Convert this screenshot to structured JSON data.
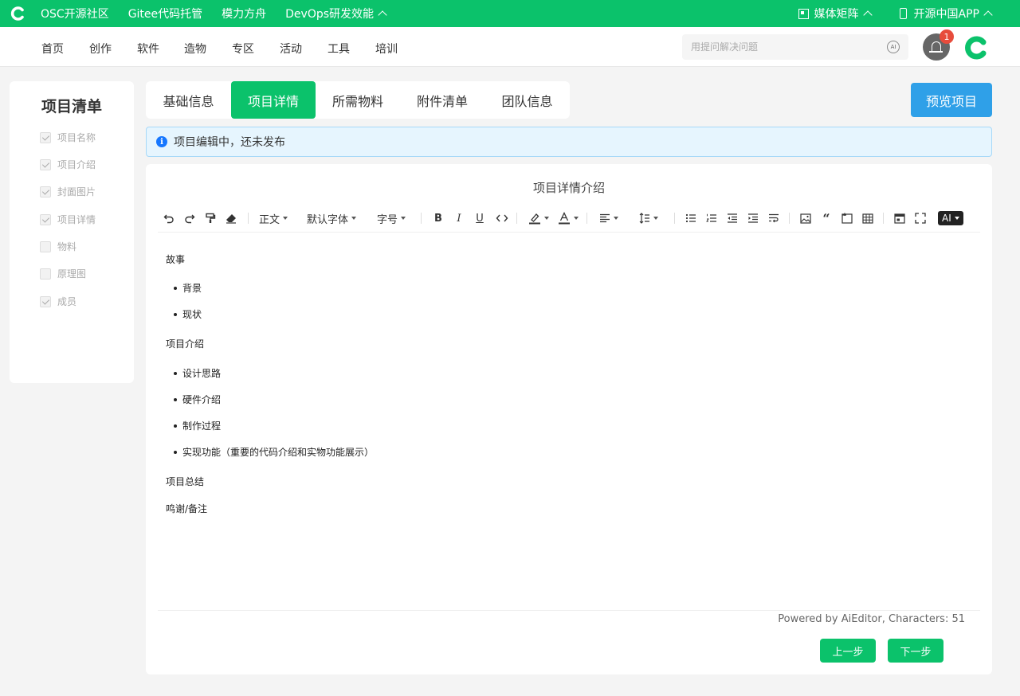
{
  "topbar": {
    "links": [
      "OSC开源社区",
      "Gitee代码托管",
      "模力方舟",
      "DevOps研发效能"
    ],
    "right_links": [
      "媒体矩阵",
      "开源中国APP"
    ]
  },
  "nav": {
    "items": [
      "首页",
      "创作",
      "软件",
      "造物",
      "专区",
      "活动",
      "工具",
      "培训"
    ],
    "search_placeholder": "用提问解决问题",
    "ai_label": "AI",
    "notification_count": "1"
  },
  "sidebar": {
    "title": "项目清单",
    "items": [
      {
        "label": "项目名称",
        "checked": true
      },
      {
        "label": "项目介绍",
        "checked": true
      },
      {
        "label": "封面图片",
        "checked": true
      },
      {
        "label": "项目详情",
        "checked": true
      },
      {
        "label": "物料",
        "checked": false
      },
      {
        "label": "原理图",
        "checked": false
      },
      {
        "label": "成员",
        "checked": true
      }
    ]
  },
  "tabs": [
    "基础信息",
    "项目详情",
    "所需物料",
    "附件清单",
    "团队信息"
  ],
  "active_tab": "项目详情",
  "preview_button": "预览项目",
  "info_message": "项目编辑中，还未发布",
  "editor": {
    "title": "项目详情介绍",
    "toolbar": {
      "paragraph": "正文",
      "font": "默认字体",
      "size": "字号",
      "ai": "AI"
    },
    "content": {
      "h1": "故事",
      "l1": "背景",
      "l2": "现状",
      "h2": "项目介绍",
      "l3": "设计思路",
      "l4": "硬件介绍",
      "l5": "制作过程",
      "l6": "实现功能（重要的代码介绍和实物功能展示）",
      "h3": "项目总结",
      "h4": "鸣谢/备注"
    },
    "footer": "Powered by AiEditor, Characters: 51"
  },
  "buttons": {
    "prev": "上一步",
    "next": "下一步"
  },
  "colors": {
    "brand_green": "#0bc26b",
    "preview_blue": "#2fa0e8",
    "badge_red": "#e74c3c",
    "info_blue": "#1677ff"
  }
}
